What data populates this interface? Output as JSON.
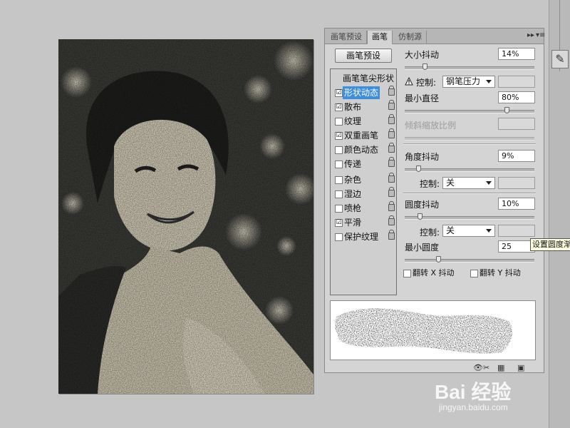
{
  "panel": {
    "tabs": [
      "画笔预设",
      "画笔",
      "仿制源"
    ],
    "active_tab_index": 1,
    "header_buttons": {
      "collapse": "▸▸",
      "menu": "▾≡"
    },
    "preset_button": "画笔预设",
    "list_header": "画笔笔尖形状",
    "items": [
      {
        "label": "形状动态",
        "checked": "☑",
        "selected": true
      },
      {
        "label": "散布",
        "checked": "☑",
        "selected": false
      },
      {
        "label": "纹理",
        "checked": "",
        "selected": false
      },
      {
        "label": "双重画笔",
        "checked": "☑",
        "selected": false
      },
      {
        "label": "颜色动态",
        "checked": "",
        "selected": false
      },
      {
        "label": "传递",
        "checked": "",
        "selected": false
      },
      {
        "label": "杂色",
        "checked": "",
        "selected": false
      },
      {
        "label": "湿边",
        "checked": "",
        "selected": false
      },
      {
        "label": "喷枪",
        "checked": "",
        "selected": false
      },
      {
        "label": "平滑",
        "checked": "☑",
        "selected": false
      },
      {
        "label": "保护纹理",
        "checked": "",
        "selected": false
      }
    ]
  },
  "settings": {
    "size_jitter": {
      "label": "大小抖动",
      "value": "14%",
      "level": 0.14
    },
    "control1": {
      "label": "控制:",
      "value": "钢笔压力"
    },
    "min_diameter": {
      "label": "最小直径",
      "value": "80%",
      "level": 0.8
    },
    "tilt_scale": {
      "label": "倾斜缩放比例"
    },
    "angle_jitter": {
      "label": "角度抖动",
      "value": "9%",
      "level": 0.09
    },
    "control2": {
      "label": "控制:",
      "value": "关"
    },
    "roundness_jitter": {
      "label": "圆度抖动",
      "value": "10%",
      "level": 0.1
    },
    "control3": {
      "label": "控制:",
      "value": "关"
    },
    "min_roundness": {
      "label": "最小圆度",
      "value": "25",
      "level": 0.25
    },
    "flip_x": {
      "label": "翻转 X 抖动"
    },
    "flip_y": {
      "label": "翻转 Y 抖动"
    }
  },
  "tooltip": "设置圆度渐隐步",
  "watermark": {
    "logo": "Bai 经验",
    "url": "jingyan.baidu.com"
  },
  "colors": {
    "selection": "#3d8ee0",
    "panel_bg": "#d4d4d4",
    "workspace": "#c6c6c6"
  }
}
